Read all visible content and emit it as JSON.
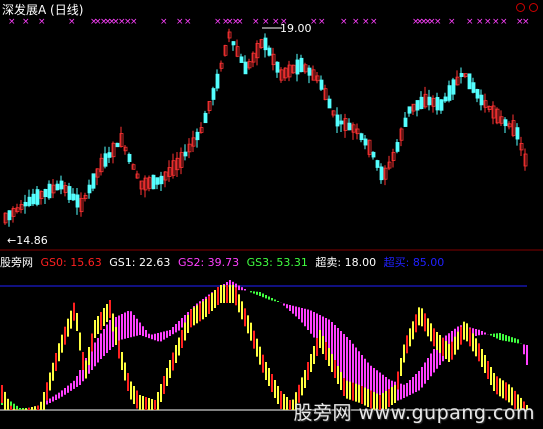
{
  "top_panel": {
    "title": "深发展A (日线)",
    "high_label": "19.00",
    "low_label": "←14.86"
  },
  "indicator": {
    "site": "股旁网",
    "gs0_label": "GS0:",
    "gs0_value": "15.63",
    "gs1_label": "GS1:",
    "gs1_value": "22.63",
    "gs2_label": "GS2:",
    "gs2_value": "39.73",
    "gs3_label": "GS3:",
    "gs3_value": "53.31",
    "overbought_label": "超卖:",
    "overbought_value": "18.00",
    "oversold_label": "超买:",
    "oversold_value": "85.00"
  },
  "watermark": "股旁网 www.gupang.com",
  "colors": {
    "up": "#ff3232",
    "down": "#54ffff",
    "gs0": "#ff2020",
    "gs1": "#ffff40",
    "gs2": "#ff40ff",
    "gs3": "#40ff40",
    "overbought": "#ffffff",
    "oversold": "#2020ff",
    "mark": "#ff40ff"
  }
}
